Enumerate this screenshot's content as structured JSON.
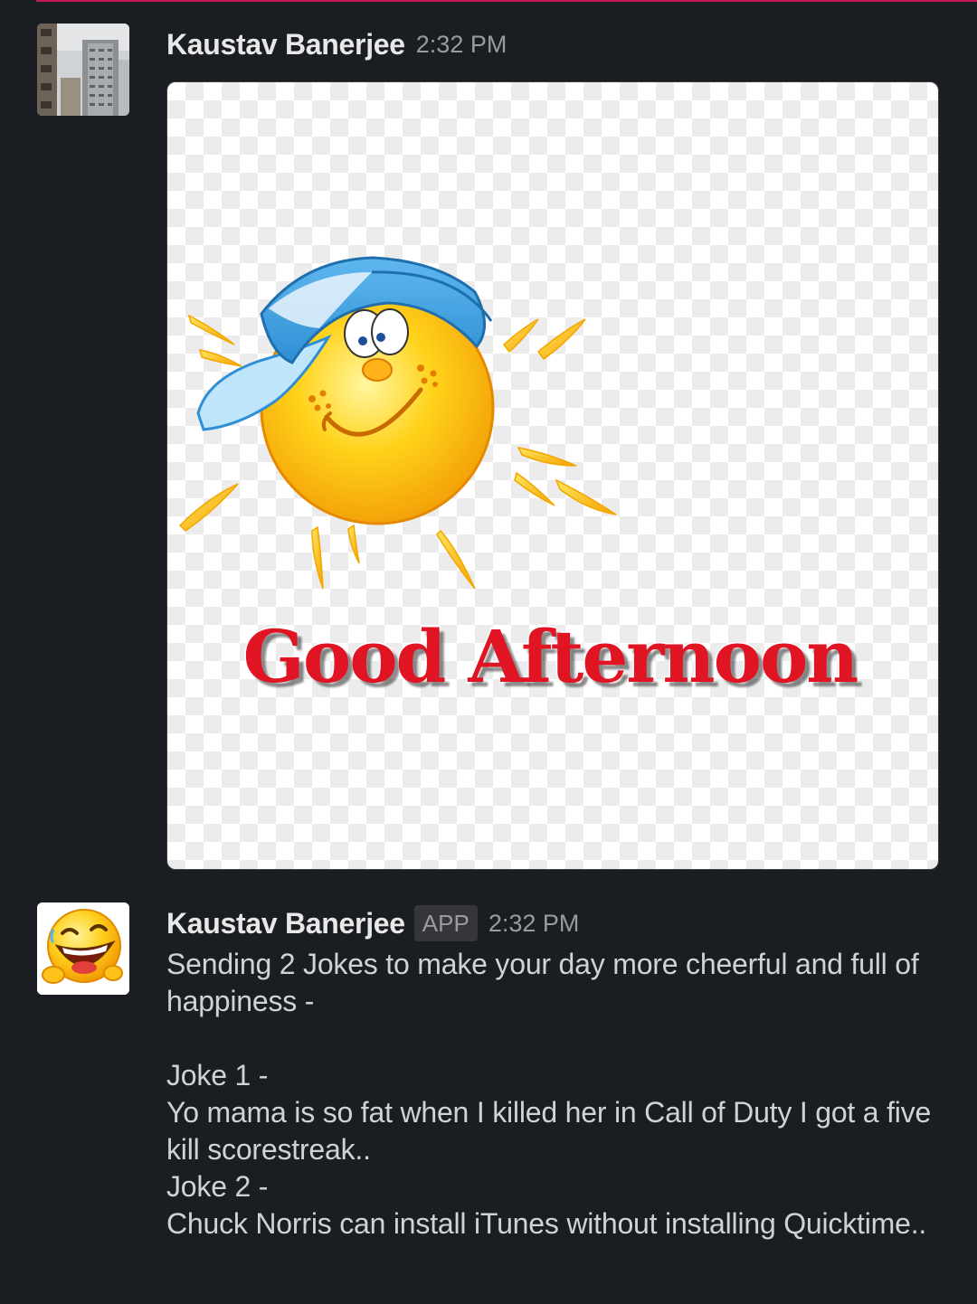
{
  "messages": [
    {
      "sender": "Kaustav Banerjee",
      "time": "2:32 PM",
      "image_caption": "Good Afternoon"
    },
    {
      "sender": "Kaustav Banerjee",
      "badge": "APP",
      "time": "2:32 PM",
      "lines": {
        "intro": "Sending 2 Jokes to make your day more cheerful and full of happiness -",
        "joke1_label": "Joke 1 -",
        "joke1_text": "Yo mama is so fat when I killed her in Call of Duty I got a five kill scorestreak..",
        "joke2_label": "Joke 2 -",
        "joke2_text": "Chuck Norris can install iTunes without installing Quicktime.."
      }
    }
  ],
  "icons": {
    "avatar1": "building-photo-avatar",
    "avatar2": "laughing-emoji-avatar",
    "sticker": "sun-with-cap-icon"
  },
  "colors": {
    "background": "#1a1d21",
    "divider": "#c2185b",
    "greeting_text": "#e01423"
  }
}
